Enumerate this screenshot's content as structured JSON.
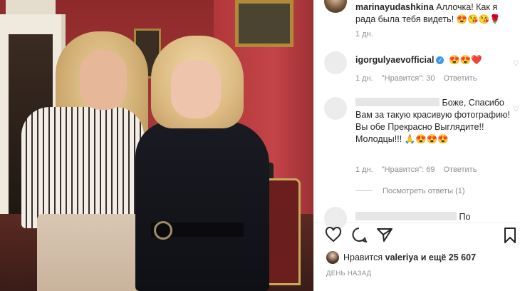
{
  "caption": {
    "username": "marinayudashkina",
    "text": "Аллочка! Как я рада была тебя видеть! 😍😘😘🌹",
    "time": "1 дн."
  },
  "comments": [
    {
      "username": "igorgulyaev official",
      "username_display": "igorgulyaevofficial",
      "verified": true,
      "text": "😍😍❤️",
      "time": "1 дн.",
      "likes": "\"Нравится\": 30",
      "reply_label": "Ответить"
    },
    {
      "username_redacted": true,
      "text": "Боже, Спасибо Вам за такую красивую фотографию! Вы обе Прекрасно Выглядите!! Молодцы!!! 🙏😍😍😍",
      "time": "1 дн.",
      "likes": "\"Нравится\": 69",
      "reply_label": "Ответить",
      "more_replies": "Посмотреть ответы (1)"
    },
    {
      "username_redacted": true,
      "text": "По"
    }
  ],
  "actions": {
    "like_icon": "heart-outline-icon",
    "comment_icon": "comment-bubble-icon",
    "share_icon": "paper-plane-icon",
    "save_icon": "bookmark-icon"
  },
  "likes_summary": {
    "prefix": "Нравится",
    "user": "valeriya",
    "suffix": "и ещё 25 607"
  },
  "timestamp": "ДЕНЬ НАЗАД",
  "colors": {
    "text": "#262626",
    "muted": "#8e8e8e",
    "verified": "#3897f0",
    "divider": "#efefef"
  }
}
